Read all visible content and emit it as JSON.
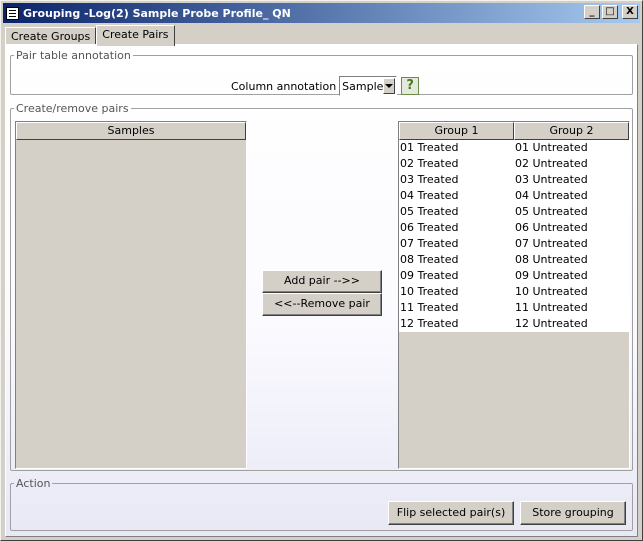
{
  "window": {
    "title": "Grouping -Log(2) Sample Probe Profile_ QN",
    "minimize_glyph": "_",
    "maximize_glyph": "□",
    "close_glyph": "X"
  },
  "tabs": [
    {
      "label": "Create Groups",
      "active": false
    },
    {
      "label": "Create Pairs",
      "active": true
    }
  ],
  "pair_table_annotation": {
    "legend": "Pair table annotation",
    "column_annotation_label": "Column annotation",
    "column_annotation_value": "Sample",
    "help_glyph": "?"
  },
  "create_remove_pairs": {
    "legend": "Create/remove pairs",
    "samples_header": "Samples",
    "add_pair_label": "Add pair -->>",
    "remove_pair_label": "<<--Remove pair",
    "pairs_headers": [
      "Group 1",
      "Group 2"
    ],
    "pairs": [
      [
        "01 Treated",
        "01 Untreated"
      ],
      [
        "02 Treated",
        "02 Untreated"
      ],
      [
        "03 Treated",
        "03 Untreated"
      ],
      [
        "04 Treated",
        "04 Untreated"
      ],
      [
        "05 Treated",
        "05 Untreated"
      ],
      [
        "06 Treated",
        "06 Untreated"
      ],
      [
        "07 Treated",
        "07 Untreated"
      ],
      [
        "08 Treated",
        "08 Untreated"
      ],
      [
        "09 Treated",
        "09 Untreated"
      ],
      [
        "10 Treated",
        "10 Untreated"
      ],
      [
        "11 Treated",
        "11 Untreated"
      ],
      [
        "12 Treated",
        "12 Untreated"
      ]
    ]
  },
  "action": {
    "legend": "Action",
    "flip_label": "Flip selected pair(s)",
    "store_label": "Store grouping"
  },
  "colors": {
    "title_start": "#0a246a",
    "title_end": "#a6caf0",
    "face": "#d4d0c8"
  }
}
